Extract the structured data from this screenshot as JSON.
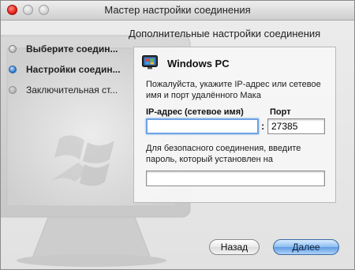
{
  "window": {
    "title": "Мастер настройки соединения"
  },
  "sidebar": {
    "steps": [
      {
        "label": "Выберите соедин...",
        "state": "done"
      },
      {
        "label": "Настройки соедин...",
        "state": "active"
      },
      {
        "label": "Заключительная ст...",
        "state": "pending"
      }
    ]
  },
  "main": {
    "section_title": "Дополнительные настройки соединения",
    "pc_title": "Windows PC",
    "instructions": "Пожалуйста, укажите IP-адрес или сетевое имя и порт удалённого Мака",
    "ip_label": "IP-адрес (сетевое имя)",
    "ip_value": "",
    "port_label": "Порт",
    "port_value": "27385",
    "colon": ":",
    "secure_text": "Для безопасного соединения, введите пароль, который установлен на",
    "password_value": ""
  },
  "footer": {
    "back_label": "Назад",
    "next_label": "Далее"
  },
  "colors": {
    "accent": "#5f9be0",
    "focus_ring": "#6ea4e3"
  },
  "icons": {
    "pc": "windows-pc-icon",
    "background": "monitor-illustration-icon"
  }
}
